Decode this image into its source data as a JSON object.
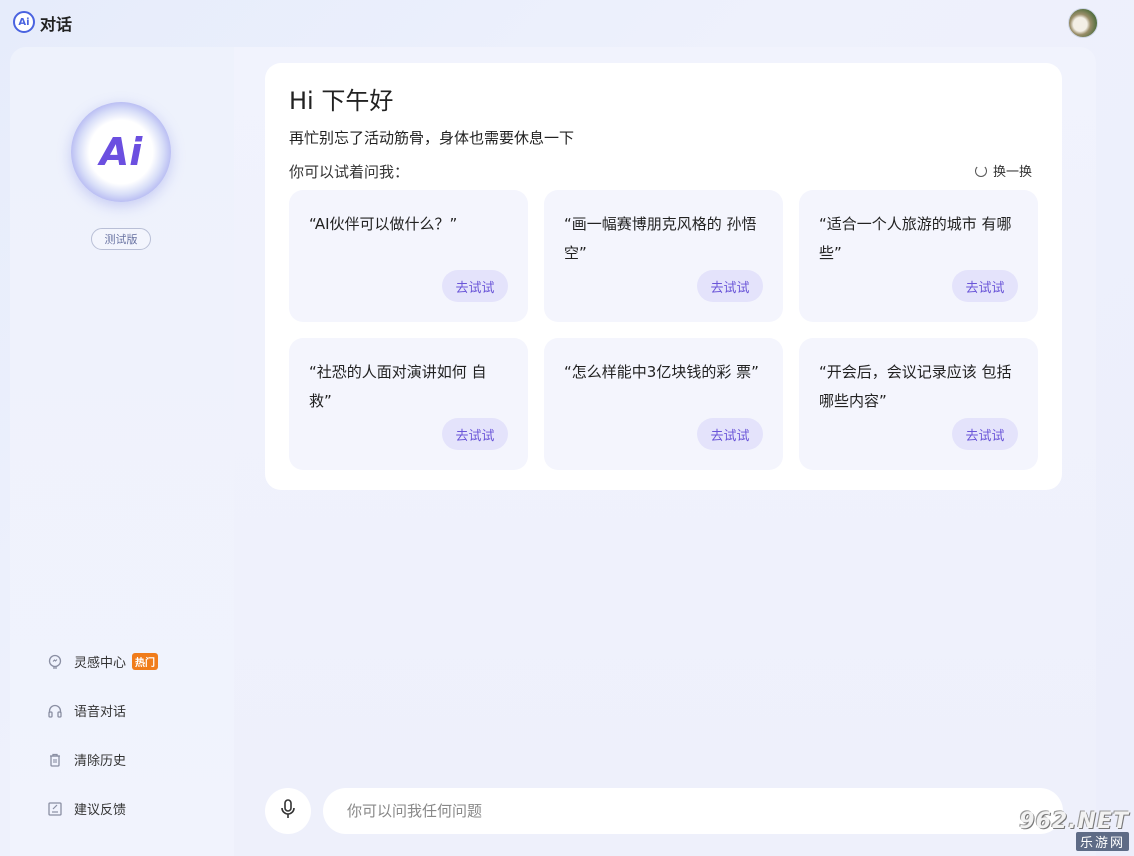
{
  "app": {
    "logo_text": "Ai",
    "title": "对话"
  },
  "sidebar": {
    "logo_text": "Ai",
    "beta_label": "测试版",
    "items": [
      {
        "label": "灵感中心",
        "icon": "lightbulb-icon",
        "badge": "热门"
      },
      {
        "label": "语音对话",
        "icon": "headphones-icon"
      },
      {
        "label": "清除历史",
        "icon": "trash-icon"
      },
      {
        "label": "建议反馈",
        "icon": "feedback-icon"
      }
    ]
  },
  "main": {
    "greeting": "Hi 下午好",
    "sub_greeting": "再忙别忘了活动筋骨，身体也需要休息一下",
    "try_ask_label": "你可以试着问我：",
    "refresh_label": "换一换",
    "suggestions": [
      {
        "text": "“AI伙伴可以做什么？”",
        "button": "去试试"
      },
      {
        "text": "“画一幅赛博朋克风格的 孙悟空”",
        "button": "去试试"
      },
      {
        "text": "“适合一个人旅游的城市 有哪些”",
        "button": "去试试"
      },
      {
        "text": "“社恐的人面对演讲如何 自救”",
        "button": "去试试"
      },
      {
        "text": "“怎么样能中3亿块钱的彩 票”",
        "button": "去试试"
      },
      {
        "text": "“开会后，会议记录应该 包括哪些内容”",
        "button": "去试试"
      }
    ]
  },
  "input": {
    "placeholder": "你可以问我任何问题",
    "value": ""
  },
  "watermark": {
    "top": "962.NET",
    "bottom": "乐游网"
  },
  "colors": {
    "accent": "#6a55d8",
    "hot_badge": "#f07c1b",
    "background": "#eef1fc"
  }
}
